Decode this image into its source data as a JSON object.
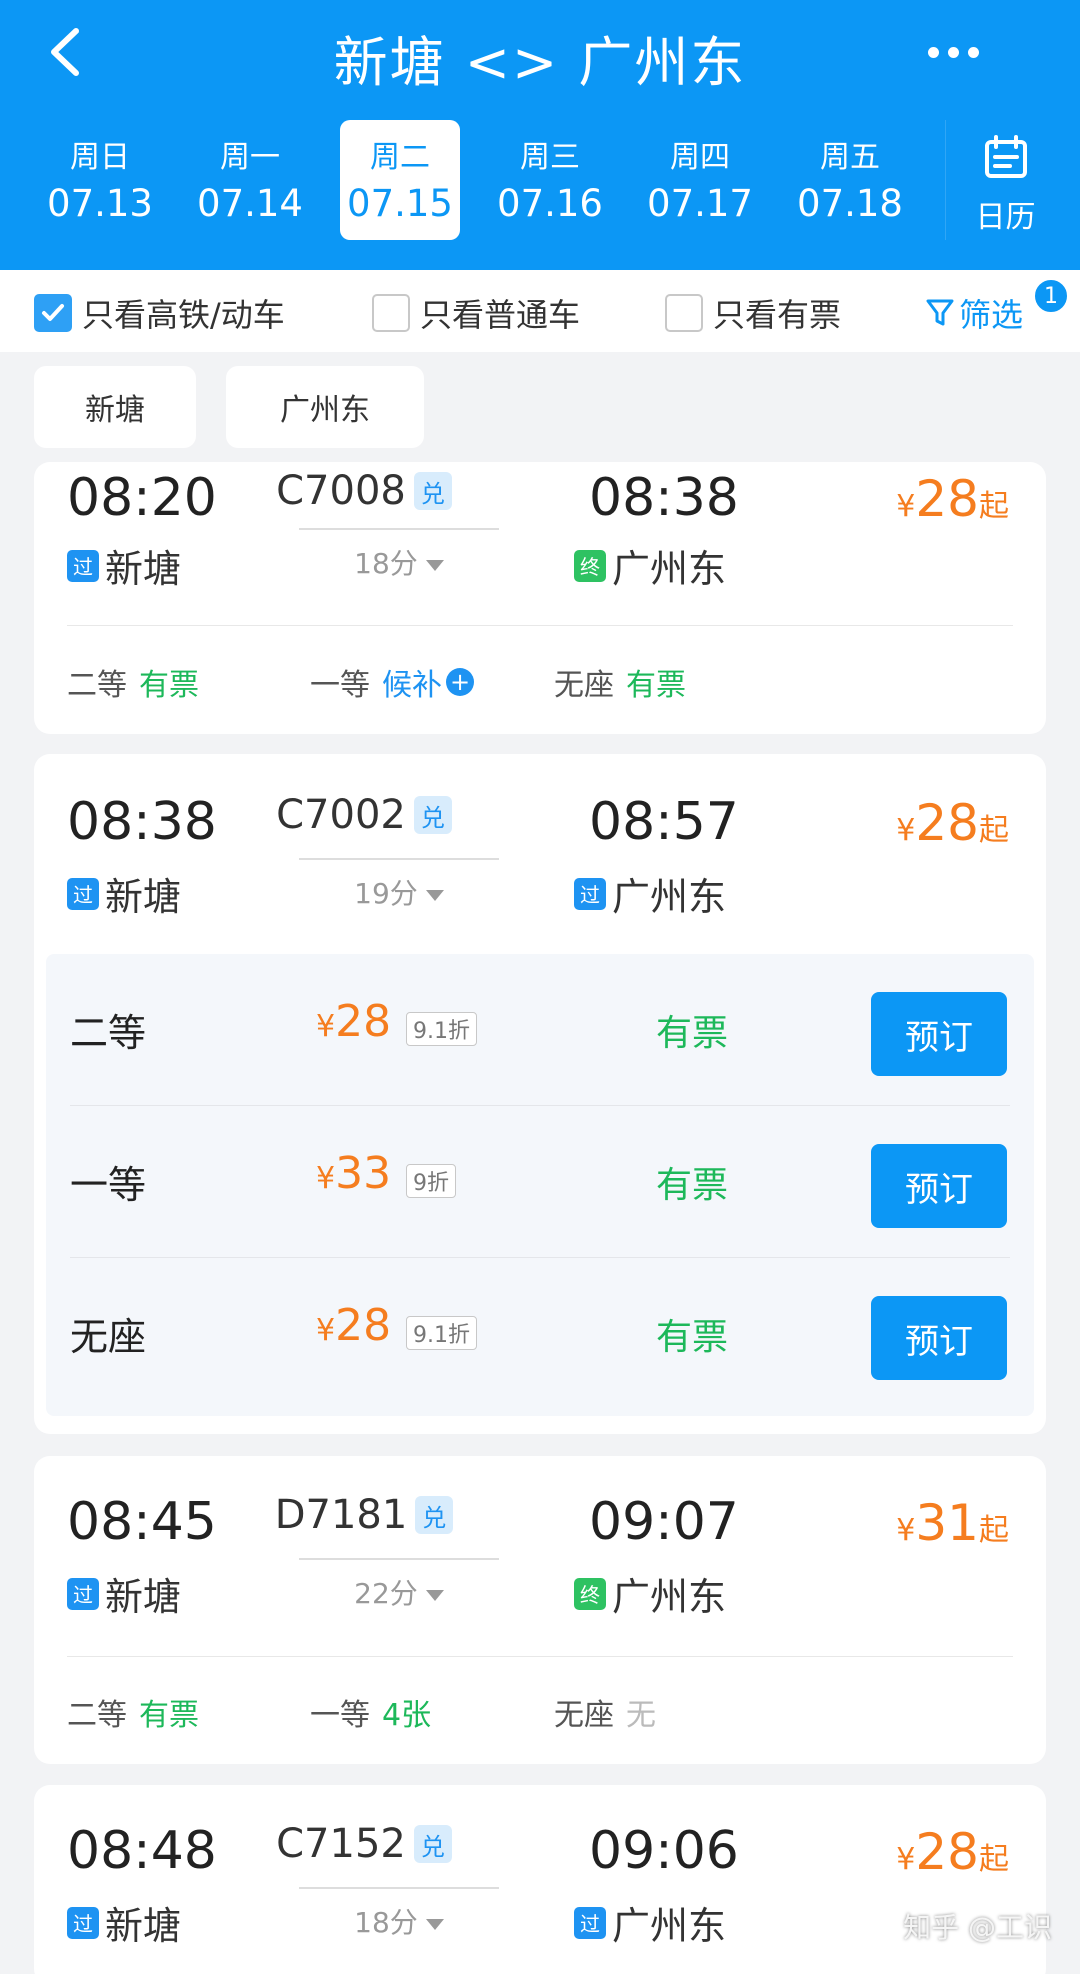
{
  "header": {
    "title": "新塘 <> 广州东",
    "dates": [
      {
        "weekday": "周日",
        "date": "07.13"
      },
      {
        "weekday": "周一",
        "date": "07.14"
      },
      {
        "weekday": "周二",
        "date": "07.15",
        "active": true
      },
      {
        "weekday": "周三",
        "date": "07.16"
      },
      {
        "weekday": "周四",
        "date": "07.17"
      },
      {
        "weekday": "周五",
        "date": "07.18"
      }
    ],
    "calendar_label": "日历"
  },
  "filters": {
    "high_speed": {
      "label": "只看高铁/动车",
      "checked": true
    },
    "normal": {
      "label": "只看普通车",
      "checked": false
    },
    "available": {
      "label": "只看有票",
      "checked": false
    },
    "screen_label": "筛选",
    "screen_badge": "1"
  },
  "stations": {
    "from": "新塘",
    "to": "广州东"
  },
  "trains": [
    {
      "dep_time": "08:20",
      "arr_time": "08:38",
      "train_no": "C7008",
      "redeem": "兑",
      "duration": "18分",
      "dep_tag": "过",
      "dep_station": "新塘",
      "arr_tag": "终",
      "arr_station": "广州东",
      "price_symbol": "¥",
      "price": "28",
      "price_suffix": "起",
      "seats": [
        {
          "cls": "二等",
          "status": "有票"
        },
        {
          "cls": "一等",
          "status": "候补"
        },
        {
          "cls": "无座",
          "status": "有票"
        }
      ]
    },
    {
      "dep_time": "08:38",
      "arr_time": "08:57",
      "train_no": "C7002",
      "redeem": "兑",
      "duration": "19分",
      "dep_tag": "过",
      "dep_station": "新塘",
      "arr_tag": "过",
      "arr_station": "广州东",
      "price_symbol": "¥",
      "price": "28",
      "price_suffix": "起",
      "expanded": [
        {
          "cls": "二等",
          "symbol": "¥",
          "price": "28",
          "discount": "9.1折",
          "status": "有票",
          "book": "预订"
        },
        {
          "cls": "一等",
          "symbol": "¥",
          "price": "33",
          "discount": "9折",
          "status": "有票",
          "book": "预订"
        },
        {
          "cls": "无座",
          "symbol": "¥",
          "price": "28",
          "discount": "9.1折",
          "status": "有票",
          "book": "预订"
        }
      ]
    },
    {
      "dep_time": "08:45",
      "arr_time": "09:07",
      "train_no": "D7181",
      "redeem": "兑",
      "duration": "22分",
      "dep_tag": "过",
      "dep_station": "新塘",
      "arr_tag": "终",
      "arr_station": "广州东",
      "price_symbol": "¥",
      "price": "31",
      "price_suffix": "起",
      "seats": [
        {
          "cls": "二等",
          "status": "有票"
        },
        {
          "cls": "一等",
          "status": "4张"
        },
        {
          "cls": "无座",
          "status": "无"
        }
      ]
    },
    {
      "dep_time": "08:48",
      "arr_time": "09:06",
      "train_no": "C7152",
      "redeem": "兑",
      "duration": "18分",
      "dep_tag": "过",
      "dep_station": "新塘",
      "arr_tag": "过",
      "arr_station": "广州东",
      "price_symbol": "¥",
      "price": "28",
      "price_suffix": "起"
    }
  ],
  "watermark": "知乎 @工识",
  "colors": {
    "brand": "#0c97f5",
    "price": "#f57d1f",
    "available": "#1db85a",
    "pass_tag": "#1e93f2",
    "end_tag": "#2ec262"
  }
}
